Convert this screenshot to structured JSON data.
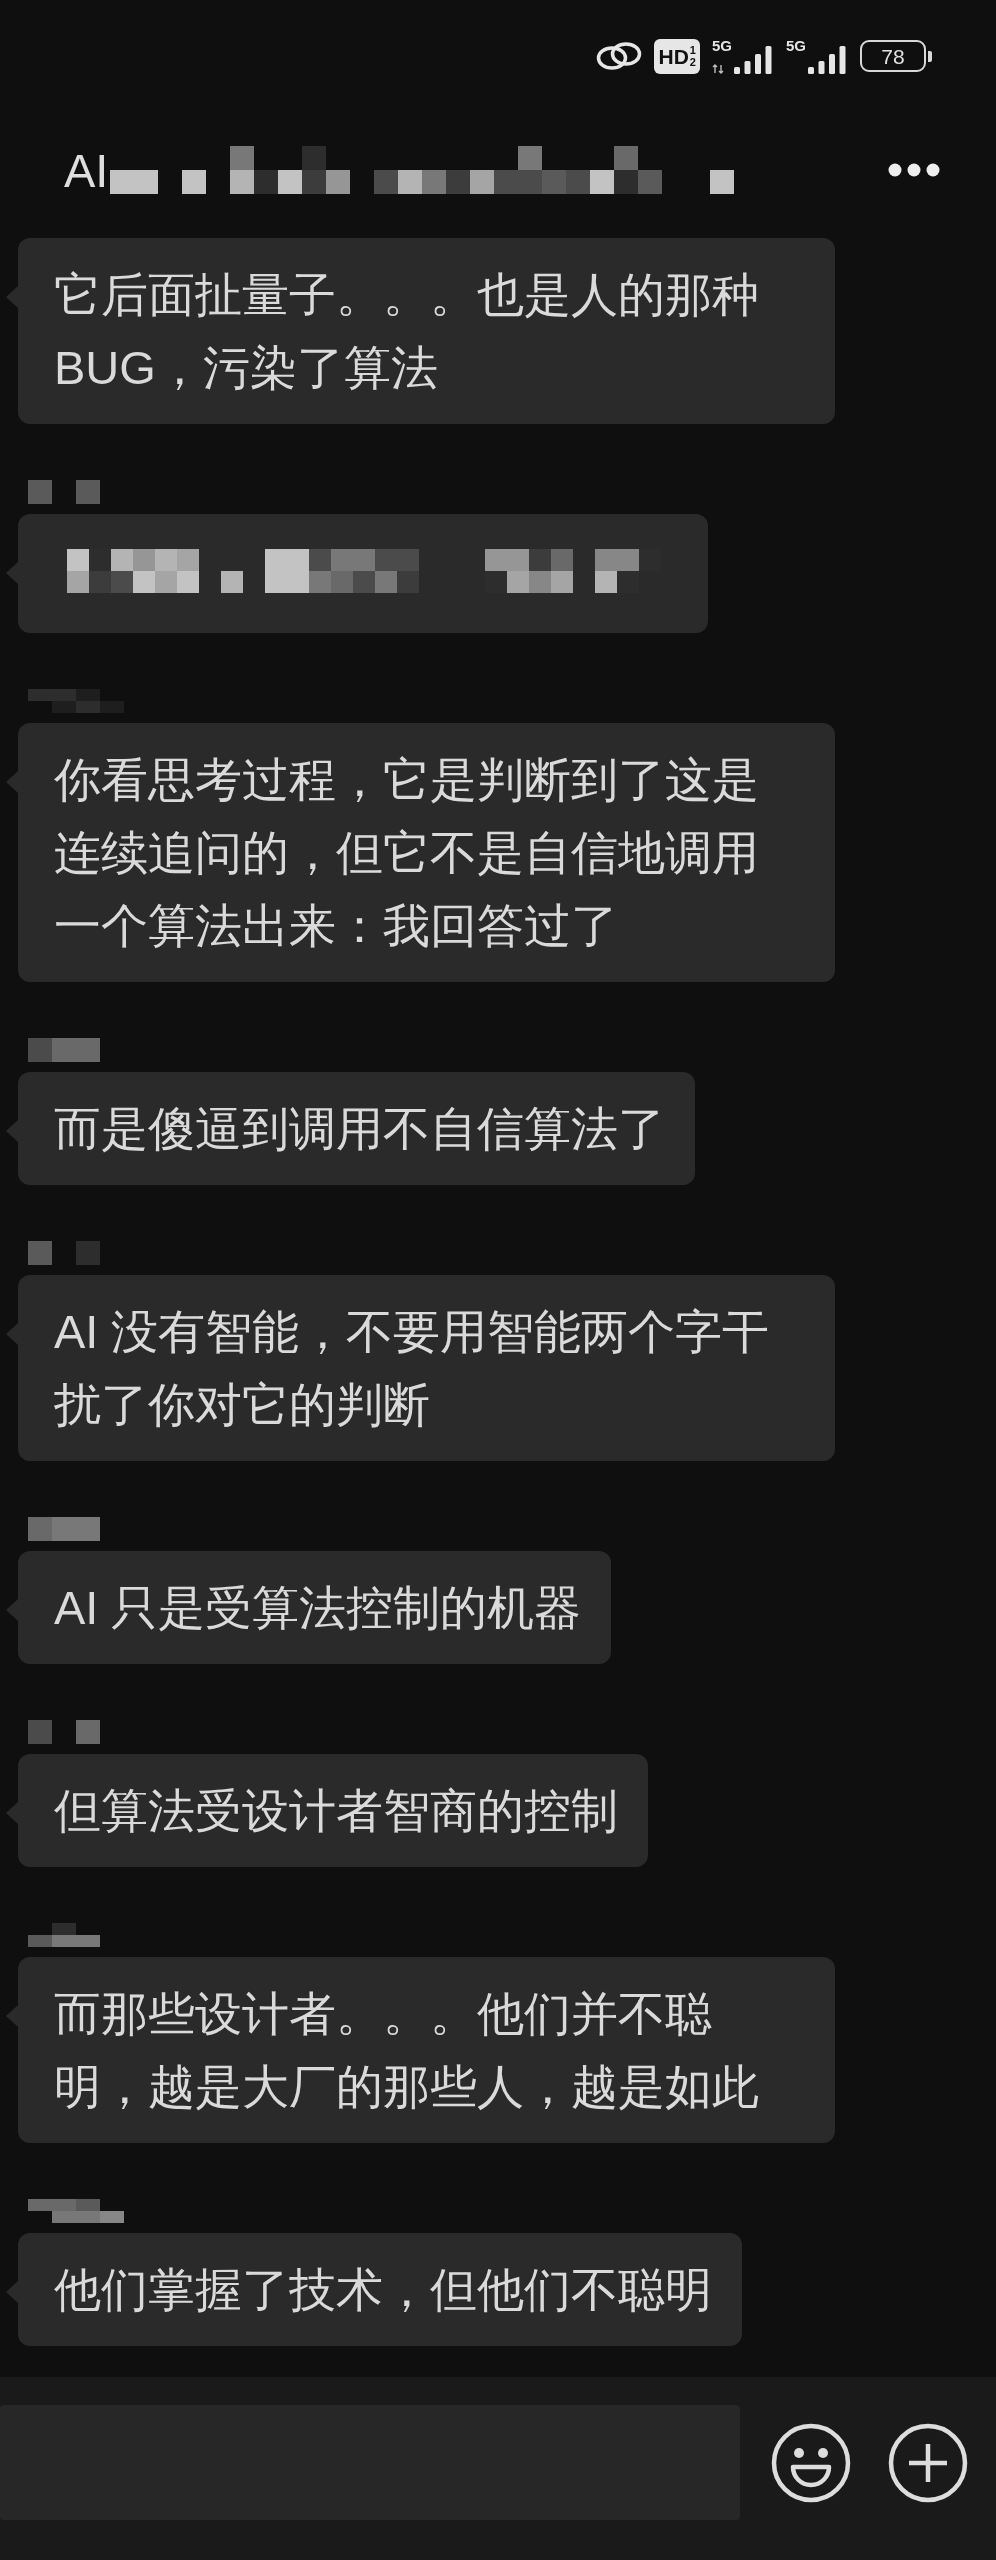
{
  "status_bar": {
    "hd_badge": {
      "label": "HD",
      "sims": [
        "1",
        "2"
      ]
    },
    "signals": [
      {
        "network": "5G",
        "data_activity": true
      },
      {
        "network": "5G",
        "data_activity": false
      }
    ],
    "battery": "78"
  },
  "header": {
    "title": "AI",
    "title_pixelated": true
  },
  "messages": [
    {
      "kind": "text",
      "sender_pixelated": false,
      "text": "它后面扯量子。。。也是人的那种BUG，污染了算法"
    },
    {
      "kind": "pixelated",
      "sender_pixelated": true
    },
    {
      "kind": "text",
      "sender_pixelated": true,
      "text": "你看思考过程，它是判断到了这是连续追问的，但它不是自信地调用一个算法出来：我回答过了"
    },
    {
      "kind": "text",
      "sender_pixelated": true,
      "text": "而是傻逼到调用不自信算法了"
    },
    {
      "kind": "text",
      "sender_pixelated": true,
      "text": "AI 没有智能，不要用智能两个字干扰了你对它的判断"
    },
    {
      "kind": "text",
      "sender_pixelated": true,
      "text": "AI 只是受算法控制的机器"
    },
    {
      "kind": "text",
      "sender_pixelated": true,
      "text": "但算法受设计者智商的控制"
    },
    {
      "kind": "text",
      "sender_pixelated": true,
      "text": "而那些设计者。。。他们并不聪明，越是大厂的那些人，越是如此"
    },
    {
      "kind": "text",
      "sender_pixelated": true,
      "text": "他们掌握了技术，但他们不聪明"
    }
  ]
}
